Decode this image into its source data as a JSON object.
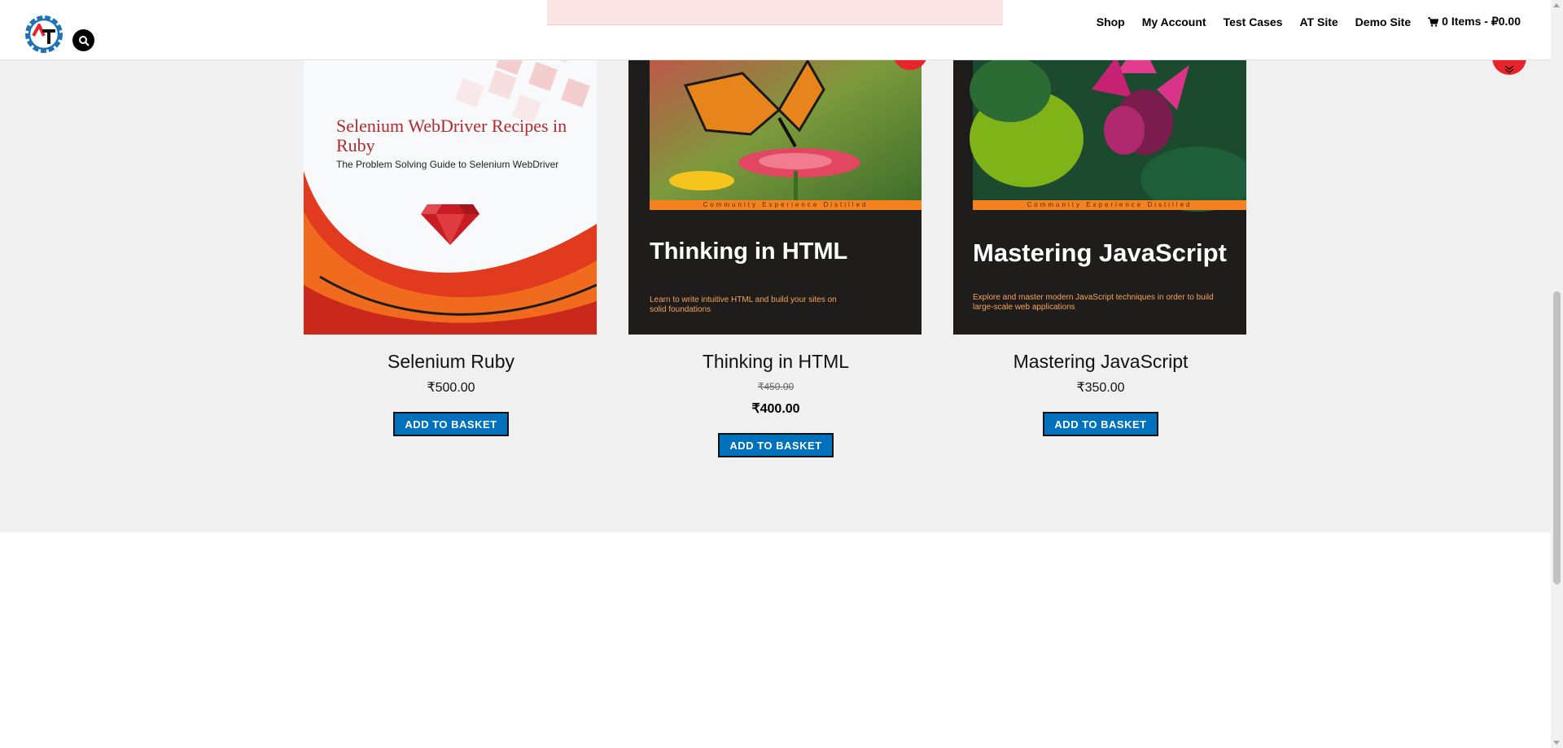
{
  "header": {
    "nav": [
      {
        "label": "Shop"
      },
      {
        "label": "My Account"
      },
      {
        "label": "Test Cases"
      },
      {
        "label": "AT Site"
      },
      {
        "label": "Demo Site"
      }
    ],
    "cart_label": "0 Items - ₽0.00"
  },
  "badge": {
    "sale": "SALE!"
  },
  "products": [
    {
      "title": "Selenium Ruby",
      "price": "₹500.00",
      "button": "ADD TO BASKET",
      "cover_title": "Selenium WebDriver Recipes in Ruby",
      "cover_subtitle": "The Problem Solving Guide to Selenium WebDriver"
    },
    {
      "title": "Thinking in HTML",
      "old_price": "₹450.00",
      "price": "₹400.00",
      "button": "ADD TO BASKET",
      "cover_band": "Community Experience Distilled",
      "cover_title": "Thinking in HTML",
      "cover_subtitle": "Learn to write intuitive HTML and build your sites on solid foundations"
    },
    {
      "title": "Mastering JavaScript",
      "price": "₹350.00",
      "button": "ADD TO BASKET",
      "cover_band": "Community Experience Distilled",
      "cover_title": "Mastering JavaScript",
      "cover_subtitle": "Explore and master modern JavaScript techniques in order to build large-scale web applications"
    }
  ],
  "colors": {
    "accent_red": "#e8232a",
    "button_blue": "#0071bc",
    "logo_blue": "#1a73b8"
  }
}
